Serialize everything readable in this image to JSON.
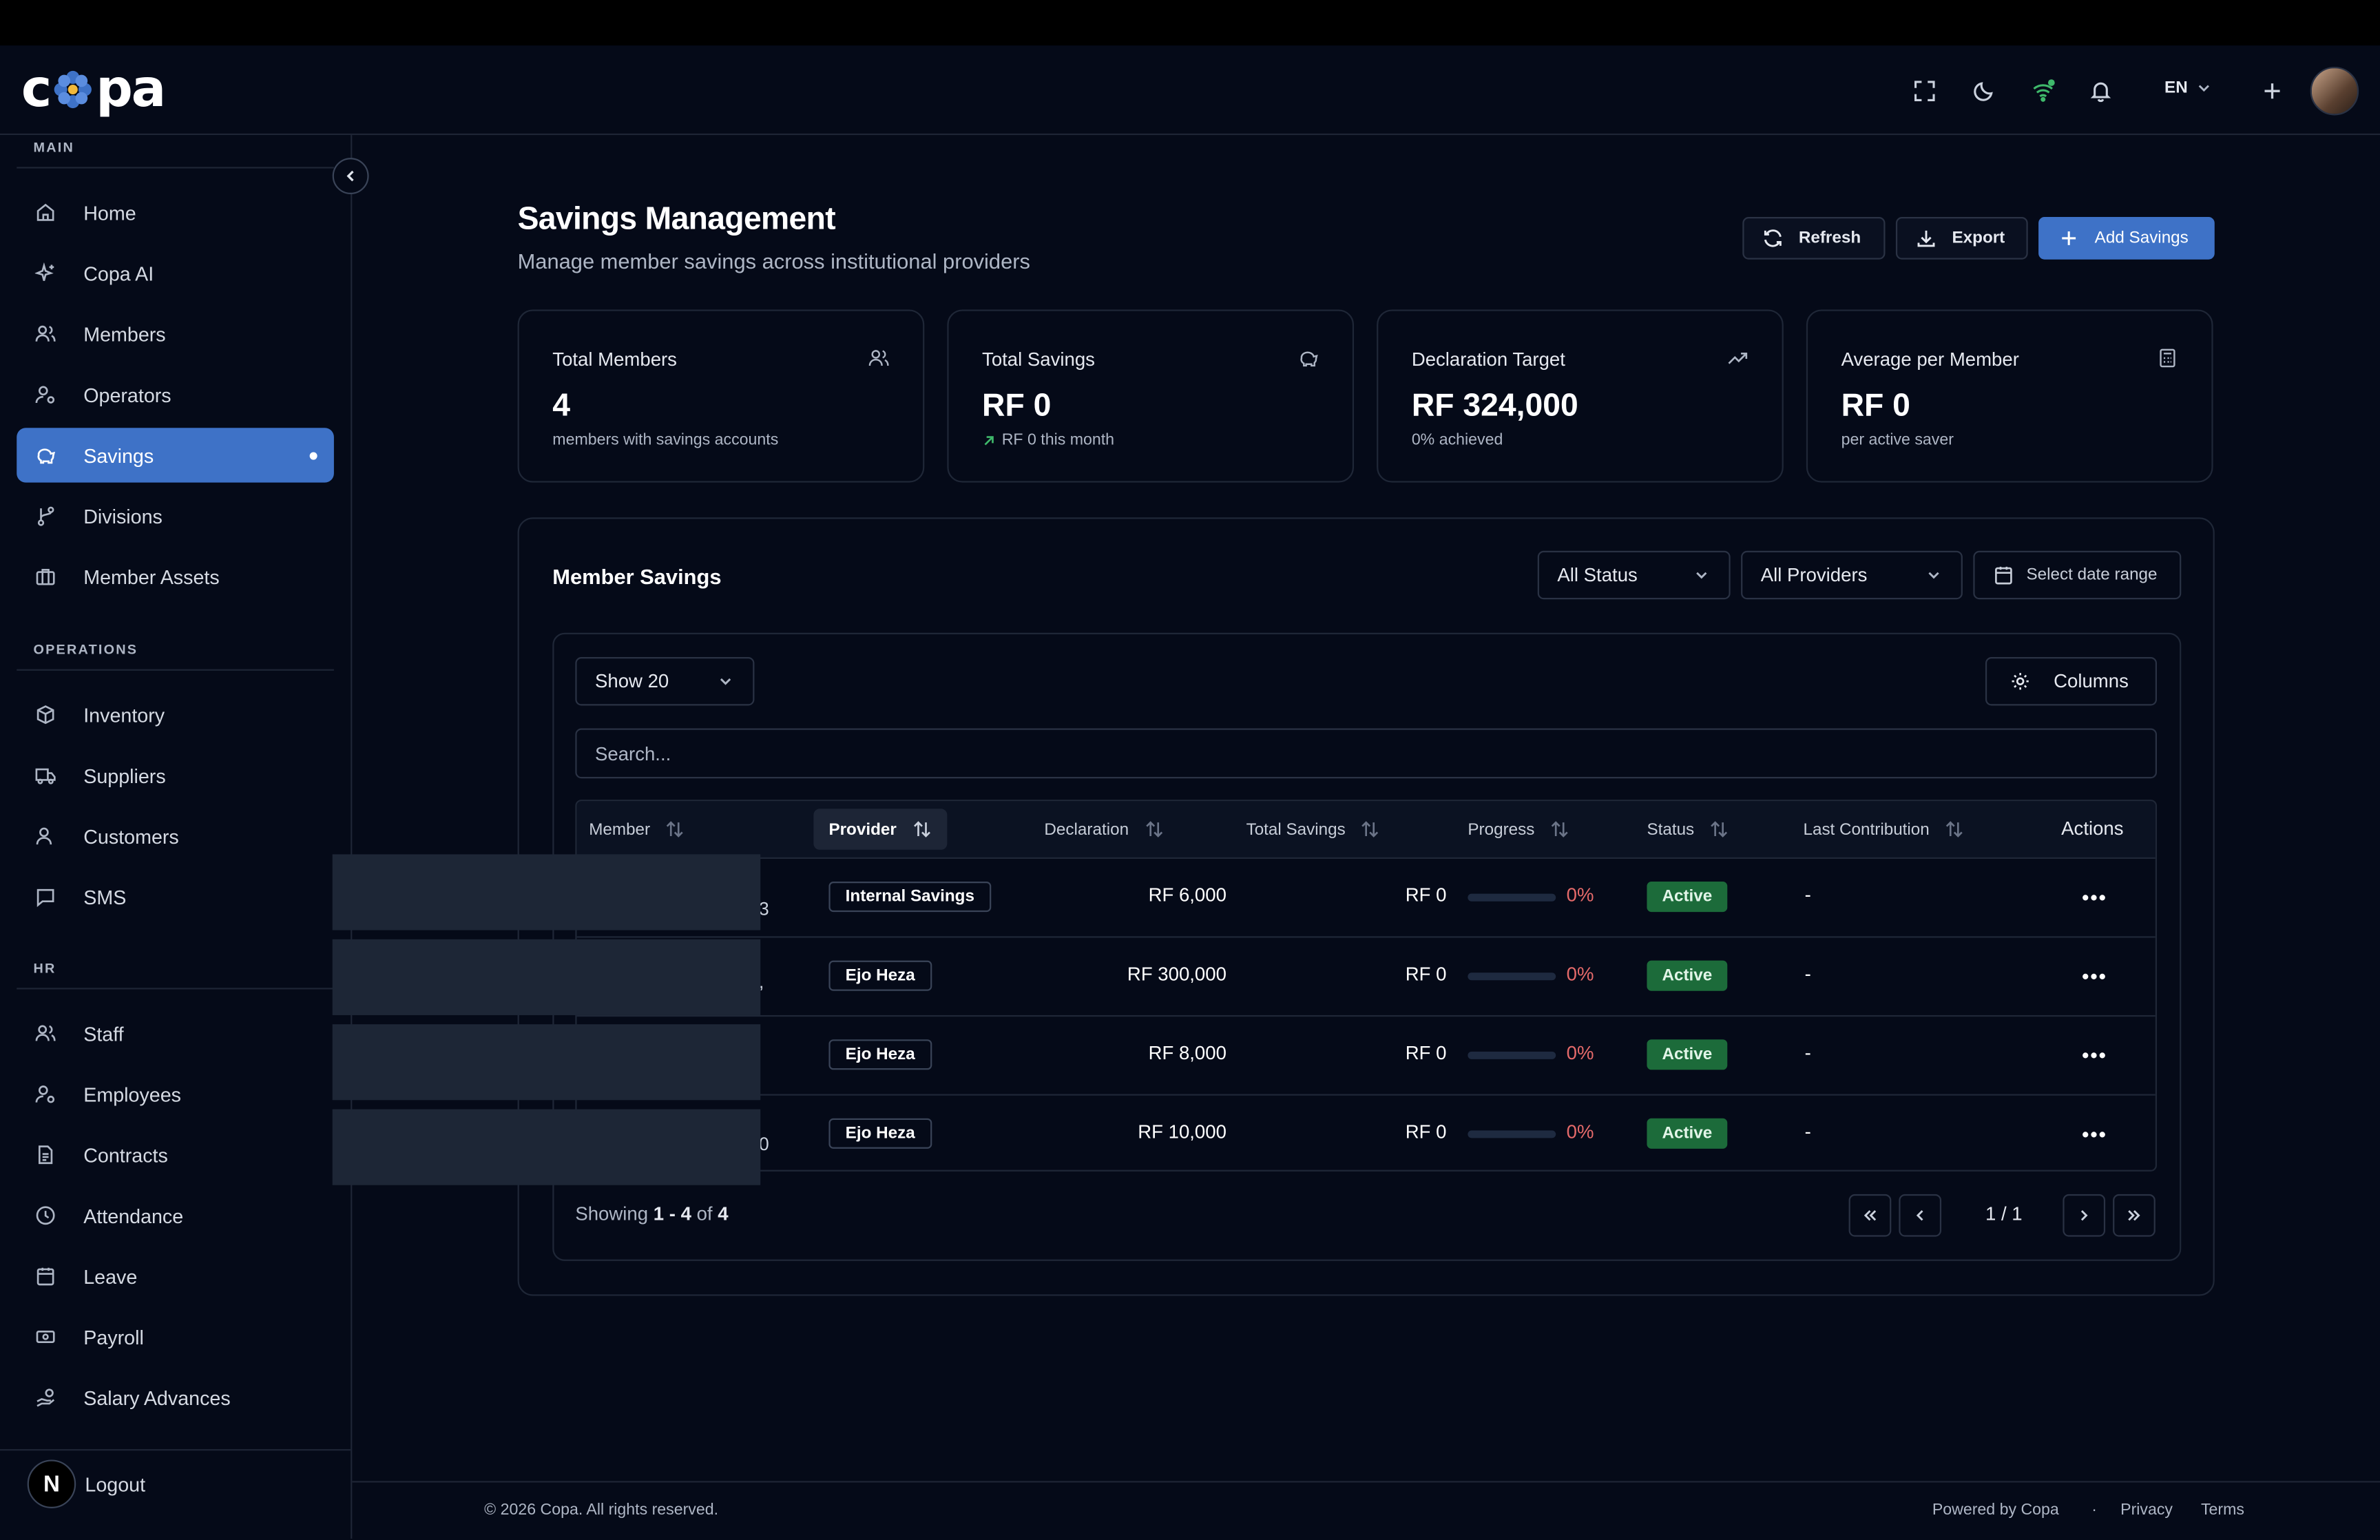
{
  "app": {
    "logo_text_left": "c",
    "logo_text_right": "pa",
    "logo_word": "copa"
  },
  "header": {
    "language": "EN",
    "icons": [
      "fullscreen-icon",
      "moon-icon",
      "wifi-icon",
      "bell-icon",
      "plus-icon"
    ]
  },
  "sidebar": {
    "sections": {
      "main": "MAIN",
      "operations": "OPERATIONS",
      "hr": "HR"
    },
    "main_items": [
      {
        "label": "Home",
        "icon": "home-icon"
      },
      {
        "label": "Copa AI",
        "icon": "sparkles-icon"
      },
      {
        "label": "Members",
        "icon": "users-icon"
      },
      {
        "label": "Operators",
        "icon": "user-cog-icon"
      },
      {
        "label": "Savings",
        "icon": "piggy-bank-icon",
        "active": true
      },
      {
        "label": "Divisions",
        "icon": "branch-icon"
      },
      {
        "label": "Member Assets",
        "icon": "briefcase-icon"
      }
    ],
    "operations_items": [
      {
        "label": "Inventory",
        "icon": "box-icon"
      },
      {
        "label": "Suppliers",
        "icon": "truck-icon"
      },
      {
        "label": "Customers",
        "icon": "user-icon"
      },
      {
        "label": "SMS",
        "icon": "message-icon"
      }
    ],
    "hr_items": [
      {
        "label": "Staff",
        "icon": "users-icon"
      },
      {
        "label": "Employees",
        "icon": "user-cog-icon"
      },
      {
        "label": "Contracts",
        "icon": "file-icon"
      },
      {
        "label": "Attendance",
        "icon": "clock-icon"
      },
      {
        "label": "Leave",
        "icon": "calendar-icon"
      },
      {
        "label": "Payroll",
        "icon": "banknote-icon"
      },
      {
        "label": "Salary Advances",
        "icon": "hand-coins-icon"
      }
    ],
    "logout": "Logout",
    "logout_badge": "N"
  },
  "page": {
    "title": "Savings Management",
    "subtitle": "Manage member savings across institutional providers",
    "buttons": {
      "refresh": "Refresh",
      "export": "Export",
      "add": "Add Savings"
    }
  },
  "stats": [
    {
      "title": "Total Members",
      "value": "4",
      "sub": "members with savings accounts",
      "icon": "users-icon"
    },
    {
      "title": "Total Savings",
      "value": "RF 0",
      "sub": "RF 0 this month",
      "icon": "piggy-bank-icon",
      "trend": true
    },
    {
      "title": "Declaration Target",
      "value": "RF 324,000",
      "sub": "0% achieved",
      "icon": "trending-up-icon"
    },
    {
      "title": "Average per Member",
      "value": "RF 0",
      "sub": "per active saver",
      "icon": "calculator-icon"
    }
  ],
  "panel": {
    "title": "Member Savings",
    "filters": {
      "status": "All Status",
      "providers": "All Providers",
      "date": "Select date range"
    },
    "page_size": "Show 20",
    "columns_button": "Columns",
    "search_placeholder": "Search...",
    "headers": {
      "member": "Member",
      "provider": "Provider",
      "declaration": "Declaration",
      "total_savings": "Total Savings",
      "progress": "Progress",
      "status": "Status",
      "last_contribution": "Last Contribution",
      "actions": "Actions"
    },
    "rows": [
      {
        "member_tail": "3",
        "provider": "Internal Savings",
        "declaration": "RF 6,000",
        "total_savings": "RF 0",
        "progress_pct": "0%",
        "progress": 0,
        "status": "Active",
        "last_contribution": "-"
      },
      {
        "member_tail": ",",
        "provider": "Ejo Heza",
        "declaration": "RF 300,000",
        "total_savings": "RF 0",
        "progress_pct": "0%",
        "progress": 0,
        "status": "Active",
        "last_contribution": "-"
      },
      {
        "member_tail": "",
        "provider": "Ejo Heza",
        "declaration": "RF 8,000",
        "total_savings": "RF 0",
        "progress_pct": "0%",
        "progress": 0,
        "status": "Active",
        "last_contribution": "-"
      },
      {
        "member_tail": "0",
        "provider": "Ejo Heza",
        "declaration": "RF 10,000",
        "total_savings": "RF 0",
        "progress_pct": "0%",
        "progress": 0,
        "status": "Active",
        "last_contribution": "-"
      }
    ],
    "showing": {
      "prefix": "Showing",
      "from": "1",
      "sep": "-",
      "to": "4",
      "of_word": "of",
      "total": "4"
    },
    "page_info": "1 / 1"
  },
  "footer": {
    "copyright": "© 2026 Copa. All rights reserved.",
    "powered": "Powered by Copa",
    "dot": "·",
    "privacy": "Privacy",
    "terms": "Terms"
  }
}
